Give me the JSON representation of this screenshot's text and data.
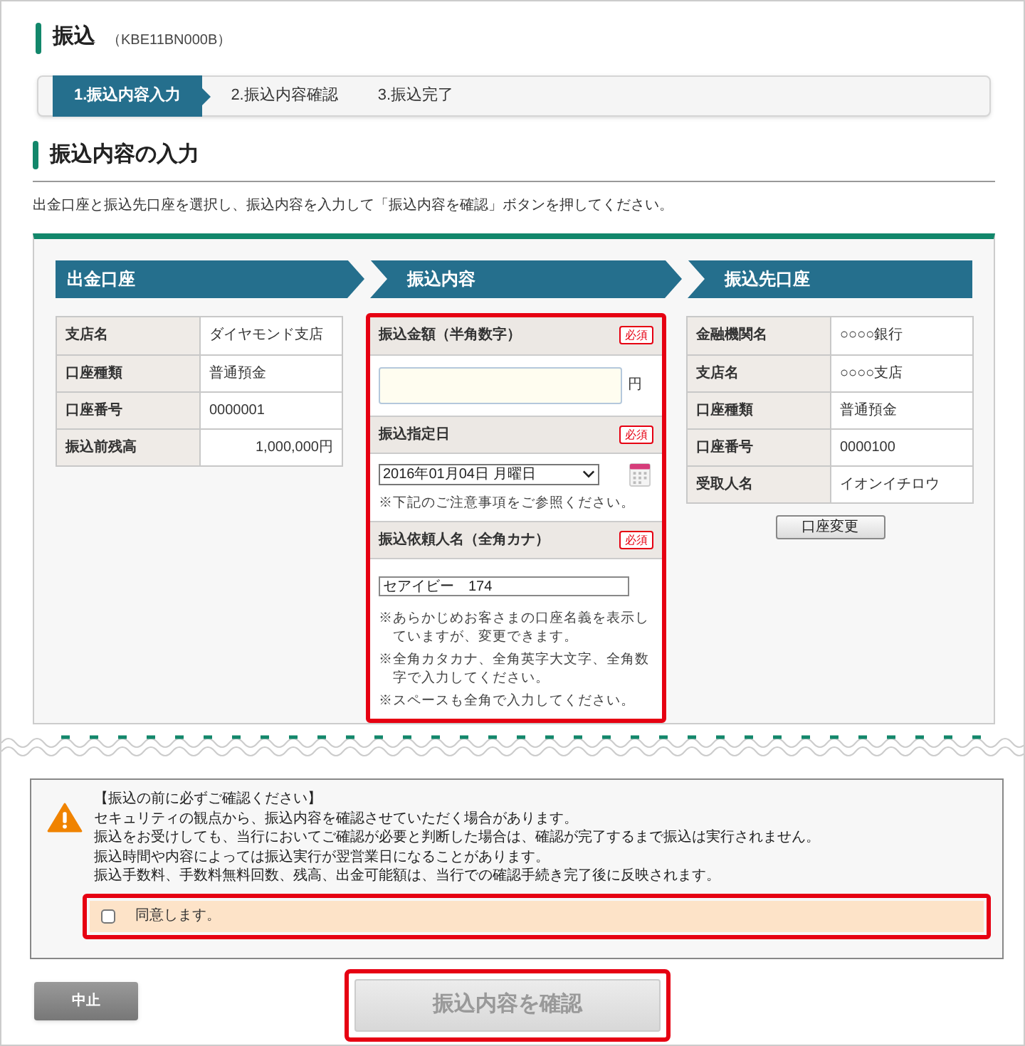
{
  "page": {
    "title": "振込",
    "screen_id": "（KBE11BN000B）"
  },
  "steps": [
    {
      "label": "1.振込内容入力",
      "selected": true
    },
    {
      "label": "2.振込内容確認",
      "selected": false
    },
    {
      "label": "3.振込完了",
      "selected": false
    }
  ],
  "section_title": "振込内容の入力",
  "description": "出金口座と振込先口座を選択し、振込内容を入力して「振込内容を確認」ボタンを押してください。",
  "source_account": {
    "header": "出金口座",
    "rows": [
      {
        "label": "支店名",
        "value": "ダイヤモンド支店",
        "numeric": false
      },
      {
        "label": "口座種類",
        "value": "普通預金",
        "numeric": false
      },
      {
        "label": "口座番号",
        "value": "0000001",
        "numeric": false
      },
      {
        "label": "振込前残高",
        "value": "1,000,000円",
        "numeric": true
      }
    ]
  },
  "transfer": {
    "header": "振込内容",
    "highlighted": true,
    "fields": [
      {
        "kind": "amount",
        "label": "振込金額（半角数字）",
        "badge": "必須",
        "unit": "円"
      },
      {
        "kind": "date",
        "label": "振込指定日",
        "badge": "必須",
        "value": "2016年01月04日 月曜日",
        "notes": [
          "※下記のご注意事項をご参照ください。"
        ]
      },
      {
        "kind": "text",
        "label": "振込依頼人名（全角カナ）",
        "badge": "必須",
        "value": "セアイビー　174",
        "notes": [
          "※あらかじめお客さまの口座名義を表示していますが、変更できます。",
          "※全角カタカナ、全角英字大文字、全角数字で入力してください。",
          "※スペースも全角で入力してください。"
        ]
      }
    ]
  },
  "destination": {
    "header": "振込先口座",
    "rows": [
      {
        "label": "金融機関名",
        "value": "○○○○銀行"
      },
      {
        "label": "支店名",
        "value": "○○○○支店"
      },
      {
        "label": "口座種類",
        "value": "普通預金"
      },
      {
        "label": "口座番号",
        "value": "0000100"
      },
      {
        "label": "受取人名",
        "value": "イオンイチロウ"
      }
    ],
    "button": "口座変更"
  },
  "notice": {
    "title": "【振込の前に必ずご確認ください】",
    "lines": [
      "セキュリティの観点から、振込内容を確認させていただく場合があります。",
      "振込をお受けしても、当行においてご確認が必要と判断した場合は、確認が完了するまで振込は実行されません。",
      "振込時間や内容によっては振込実行が翌営業日になることがあります。",
      "振込手数料、手数料無料回数、残高、出金可能額は、当行での確認手続き完了後に反映されます。"
    ],
    "agree": {
      "label": "同意します。",
      "checked": false,
      "highlighted": true
    }
  },
  "buttons": {
    "cancel": "中止",
    "confirm": {
      "label": "振込内容を確認",
      "disabled": true,
      "highlighted": true
    }
  }
}
